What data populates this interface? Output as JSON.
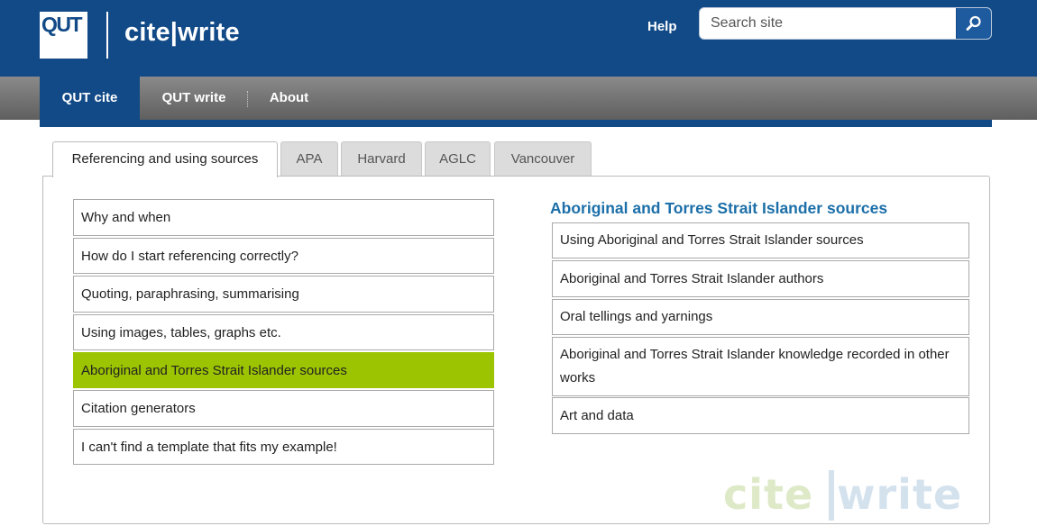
{
  "header": {
    "logo_text": "QUT",
    "site_title": "cite|write",
    "help_label": "Help",
    "search_placeholder": "Search site"
  },
  "nav": {
    "items": [
      {
        "label": "QUT cite",
        "active": true
      },
      {
        "label": "QUT write",
        "active": false
      },
      {
        "label": "About",
        "active": false
      }
    ]
  },
  "tabs": [
    {
      "label": "Referencing and using sources",
      "active": true
    },
    {
      "label": "APA",
      "active": false
    },
    {
      "label": "Harvard",
      "active": false
    },
    {
      "label": "AGLC",
      "active": false
    },
    {
      "label": "Vancouver",
      "active": false
    }
  ],
  "left_list": [
    {
      "label": "Why and when",
      "selected": false
    },
    {
      "label": "How do I start referencing correctly?",
      "selected": false
    },
    {
      "label": "Quoting, paraphrasing, summarising",
      "selected": false
    },
    {
      "label": "Using images, tables, graphs etc.",
      "selected": false
    },
    {
      "label": "Aboriginal and Torres Strait Islander sources",
      "selected": true
    },
    {
      "label": "Citation generators",
      "selected": false
    },
    {
      "label": "I can't find a template that fits my example!",
      "selected": false
    }
  ],
  "right_section": {
    "heading": "Aboriginal and Torres Strait Islander sources",
    "items": [
      {
        "label": "Using Aboriginal and Torres Strait Islander sources"
      },
      {
        "label": "Aboriginal and Torres Strait Islander authors"
      },
      {
        "label": "Oral tellings and yarnings"
      },
      {
        "label": "Aboriginal and Torres Strait Islander knowledge recorded in other works"
      },
      {
        "label": "Art and data"
      }
    ]
  },
  "watermark": {
    "cite": "cite",
    "write": "write"
  },
  "colors": {
    "brand_blue": "#124a87",
    "selected_green": "#9cc400",
    "heading_blue": "#1c6fa8"
  },
  "icons": {
    "search": "search-icon",
    "logo": "qut-logo"
  }
}
